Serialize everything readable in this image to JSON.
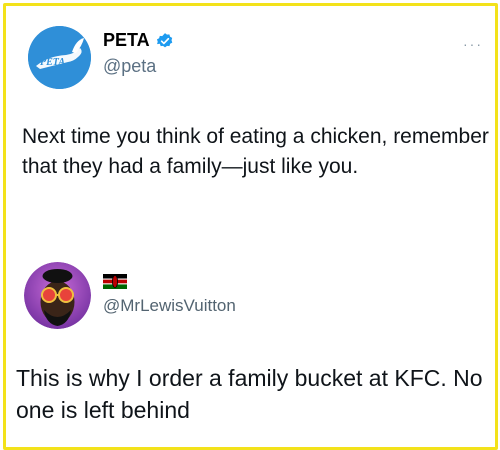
{
  "tweet": {
    "author_name": "PETA",
    "handle": "@peta",
    "more_label": "···",
    "avatar_logo_text": "PETA",
    "text": "Next time you think of eating a chicken, remember that they had a family—just like you."
  },
  "reply": {
    "handle": "@MrLewisVuitton",
    "text": "This is why I order a family bucket at KFC. No one is left behind"
  },
  "colors": {
    "border": "#f3e21a",
    "peta_blue": "#2f8fd8",
    "verified_blue": "#1d9bf0",
    "handle_gray": "#5b7083"
  }
}
